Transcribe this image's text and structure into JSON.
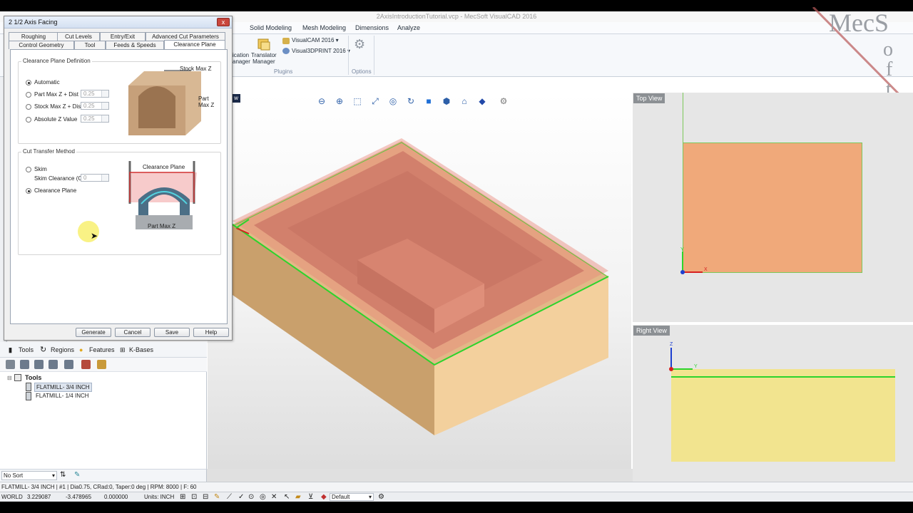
{
  "app": {
    "title": "2AxisIntroductionTutorial.vcp - MecSoft VisualCAD 2016",
    "logo_text": "MecSoft"
  },
  "ribbon": {
    "tabs": [
      "Solid Modeling",
      "Mesh Modeling",
      "Dimensions",
      "Analyze"
    ],
    "partial_item": "ication\nanager",
    "translator": "Translator\nManager",
    "visualcam": "VisualCAM 2016",
    "visual3dprint": "Visual3DPRINT 2016",
    "group_plugins": "Plugins",
    "group_options": "Options"
  },
  "dialog": {
    "title": "2 1/2 Axis Facing",
    "close": "x",
    "tabs_row1": [
      "Roughing",
      "Cut Levels",
      "Entry/Exit",
      "Advanced Cut Parameters"
    ],
    "tabs_row2": [
      "Control Geometry",
      "Tool",
      "Feeds & Speeds",
      "Clearance Plane"
    ],
    "clearance_group": "Clearance Plane Definition",
    "options": [
      {
        "label": "Automatic",
        "selected": true
      },
      {
        "label": "Part Max Z + Dist",
        "value": "0.25",
        "selected": false
      },
      {
        "label": "Stock Max Z + Dist",
        "value": "0.25",
        "selected": false
      },
      {
        "label": "Absolute Z Value",
        "value": "0.25",
        "selected": false
      }
    ],
    "img1_label_top": "Stock Max Z",
    "img1_label_side": "Part\nMax Z",
    "transfer_group": "Cut Transfer Method",
    "skim_label": "Skim",
    "skim_clearance_label": "Skim Clearance (C)",
    "skim_clearance_value": "0",
    "clearance_option": "Clearance Plane",
    "img2_label_top": "Clearance Plane",
    "img2_label_bottom": "Part Max Z",
    "buttons": {
      "generate": "Generate",
      "cancel": "Cancel",
      "save": "Save",
      "help": "Help"
    }
  },
  "tree": {
    "tabs": [
      "Tools",
      "Regions",
      "Features",
      "K-Bases"
    ],
    "root": "Tools",
    "items": [
      "FLATMILL- 3/4 INCH",
      "FLATMILL- 1/4 INCH"
    ],
    "sort": "No Sort"
  },
  "status": {
    "tool_info": "FLATMILL- 3/4 INCH | #1 | Dia0.75, CRad:0, Taper:0 deg | RPM: 8000 | F: 60",
    "coord_system": "WORLD",
    "x": "3.229087",
    "y": "-3.478965",
    "z": "0.000000",
    "units": "Units: INCH",
    "layer": "Default"
  },
  "views": {
    "top": "Top View",
    "right": "Right View",
    "main_tab_partial": "w"
  },
  "axes": {
    "x": "X",
    "y": "Y",
    "z": "Z"
  },
  "colors": {
    "accent": "#2d5fa8",
    "stock": "#e8c28e",
    "part": "#c7836a",
    "selection": "#2cd42c",
    "top_fill": "#f0a97a",
    "right_fill": "#f2e48f"
  }
}
